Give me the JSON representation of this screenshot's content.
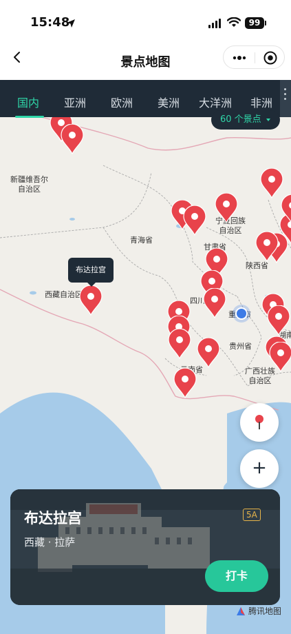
{
  "status_bar": {
    "time": "15:48",
    "battery": "99",
    "icons": [
      "location-arrow-icon",
      "cellular-signal-icon",
      "wifi-icon",
      "battery-icon"
    ]
  },
  "nav": {
    "title": "景点地图",
    "icons": [
      "back-chevron-icon",
      "more-dots-icon",
      "close-target-icon"
    ]
  },
  "tabs": [
    {
      "label": "国内",
      "active": true
    },
    {
      "label": "亚洲",
      "active": false
    },
    {
      "label": "欧洲",
      "active": false
    },
    {
      "label": "美洲",
      "active": false
    },
    {
      "label": "大洋洲",
      "active": false
    },
    {
      "label": "非洲",
      "active": false
    }
  ],
  "count_pill": {
    "label": "60 个景点"
  },
  "map": {
    "regions": [
      {
        "id": "xinjiang",
        "label": "新疆维吾尔\n自治区"
      },
      {
        "id": "qinghai",
        "label": "青海省"
      },
      {
        "id": "tibet",
        "label": "西藏自治区"
      },
      {
        "id": "ningxia",
        "label": "宁夏回族\n自治区"
      },
      {
        "id": "gansu",
        "label": "甘肃省"
      },
      {
        "id": "shaanxi",
        "label": "陕西省"
      },
      {
        "id": "sichuan",
        "label": "四川"
      },
      {
        "id": "chongqing",
        "label": "重庆市"
      },
      {
        "id": "guizhou",
        "label": "贵州省"
      },
      {
        "id": "yunnan",
        "label": "云南省"
      },
      {
        "id": "guangxi",
        "label": "广西壮族\n自治区"
      },
      {
        "id": "hunan",
        "label": "湖南"
      },
      {
        "id": "shanxi",
        "label": "山"
      }
    ],
    "selected_tooltip": "布达拉宫",
    "pin_color": "#e8434b",
    "accent_color": "#2fd6a8"
  },
  "card": {
    "name": "布达拉宫",
    "location": "西藏 · 拉萨",
    "grade": "5A",
    "checkin_label": "打卡"
  },
  "zoom_label": "+",
  "attribution": "腾讯地图"
}
